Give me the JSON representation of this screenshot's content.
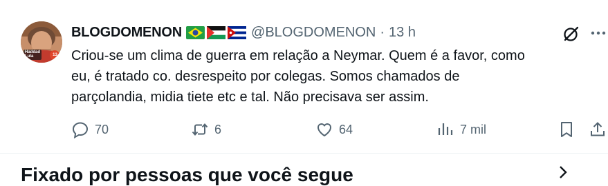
{
  "tweet": {
    "author_name": "BLOGDOMENON",
    "author_flags": [
      "brazil-flag",
      "palestine-flag",
      "cuba-flag"
    ],
    "handle": "@BLOGDOMENON",
    "separator": "·",
    "time": "13 h",
    "avatar_badge_text": "Haddad Lula",
    "avatar_badge_number": "13",
    "text_lines": [
      "Criou-se um clima de guerra em relação a Neymar. Quem é a favor, como",
      "eu, é tratado co. desrespeito por colegas. Somos chamados de",
      "parçolandia, midia tiete etc e tal. Não precisava ser assim."
    ],
    "actions": {
      "replies": "70",
      "retweets": "6",
      "likes": "64",
      "views": "7 mil"
    },
    "icons": {
      "reply": "reply-icon",
      "retweet": "retweet-icon",
      "like": "heart-icon",
      "views": "views-icon",
      "bookmark": "bookmark-icon",
      "share": "share-icon",
      "grok": "grok-icon",
      "more": "more-icon"
    }
  },
  "section": {
    "title_partial": "Fixado por pessoas que você segue"
  },
  "colors": {
    "text": "#0f1419",
    "muted": "#536471",
    "divider": "#eff3f4"
  }
}
